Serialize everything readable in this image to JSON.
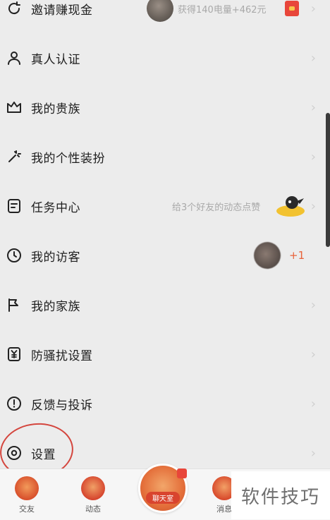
{
  "menu": [
    {
      "label": "邀请赚现金",
      "icon": "refresh-icon",
      "sub": "获得140电量+462元"
    },
    {
      "label": "真人认证",
      "icon": "person-icon"
    },
    {
      "label": "我的贵族",
      "icon": "crown-icon"
    },
    {
      "label": "我的个性装扮",
      "icon": "magic-wand-icon"
    },
    {
      "label": "任务中心",
      "icon": "task-icon",
      "sub": "给3个好友的动态点赞"
    },
    {
      "label": "我的访客",
      "icon": "clock-icon",
      "badge": "+1"
    },
    {
      "label": "我的家族",
      "icon": "flag-icon"
    },
    {
      "label": "防骚扰设置",
      "icon": "shield-yen-icon"
    },
    {
      "label": "反馈与投诉",
      "icon": "alert-icon"
    },
    {
      "label": "设置",
      "icon": "settings-icon"
    }
  ],
  "chevron": "›",
  "tabs": [
    {
      "label": "交友"
    },
    {
      "label": "动态"
    },
    {
      "label": "聊天室"
    },
    {
      "label": "消息"
    }
  ],
  "watermark": "软件技巧",
  "colors": {
    "accent": "#e8623a",
    "annotation": "#d4463e",
    "background": "#ececec"
  }
}
